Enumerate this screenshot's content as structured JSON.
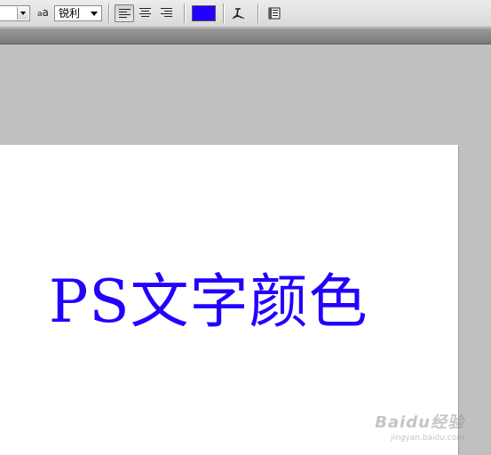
{
  "options_bar": {
    "antialias_icon": "aa",
    "antialias_value": "锐利",
    "align_buttons": [
      "align-left",
      "align-center",
      "align-right"
    ],
    "active_align": "align-left",
    "text_color": "#2200ff",
    "warp_icon": "warp-text-icon",
    "panel_icon": "character-panel-icon"
  },
  "canvas": {
    "text": "PS文字颜色",
    "text_color": "#2200ff",
    "background": "#ffffff"
  },
  "workspace": {
    "background": "#c0c0c0"
  },
  "watermark": {
    "main": "Baidu经验",
    "sub": "jingyan.baidu.com"
  }
}
